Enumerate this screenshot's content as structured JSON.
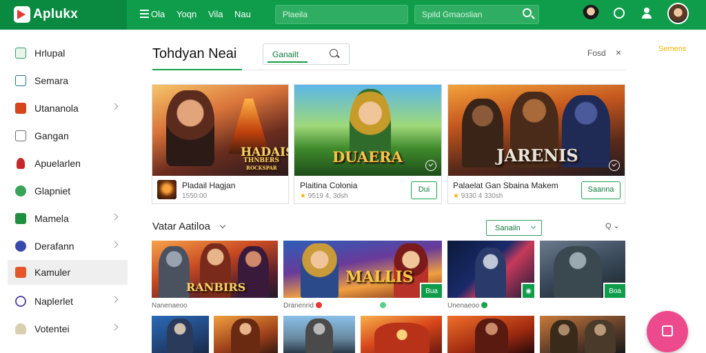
{
  "topbar": {
    "brand": "Aplukx",
    "nav": [
      "Yoqn",
      "Vila",
      "Nau"
    ],
    "menu_label": "Ola",
    "search_placeholder": "Plaeila",
    "search2_placeholder": "Spild Gmaoslian"
  },
  "sidebar": {
    "items": [
      {
        "label": "Hrlupal",
        "icon": "app-icon",
        "color": "#2e9e5d",
        "chev": false
      },
      {
        "label": "Semara",
        "icon": "monitor-icon",
        "color": "#1f6f9f",
        "chev": false
      },
      {
        "label": "Utananola",
        "icon": "grid-icon",
        "color": "#d6451b",
        "chev": true
      },
      {
        "label": "Gangan",
        "icon": "window-icon",
        "color": "#6b6b6b",
        "chev": false
      },
      {
        "label": "Apuelarlen",
        "icon": "person-icon",
        "color": "#c62828",
        "chev": false
      },
      {
        "label": "Glapniet",
        "icon": "leaf-icon",
        "color": "#3aa35a",
        "chev": false
      },
      {
        "label": "Mamela",
        "icon": "play-icon",
        "color": "#1f8f3f",
        "chev": true
      },
      {
        "label": "Derafann",
        "icon": "circle-icon",
        "color": "#3949ab",
        "chev": true
      },
      {
        "label": "Kamuler",
        "icon": "flag-icon",
        "color": "#e5572a",
        "chev": false
      },
      {
        "label": "Naplerlet",
        "icon": "ring-icon",
        "color": "#5b4aa8",
        "chev": true
      },
      {
        "label": "Votentei",
        "icon": "user-icon",
        "color": "#8a7a4f",
        "chev": true
      }
    ]
  },
  "main": {
    "title": "Tohdyan Neai",
    "filter_label": "Ganailt",
    "head_link": "Fosd",
    "close_glyph": "×",
    "promo": "Semens",
    "featured": [
      {
        "art_text": "HADAIS",
        "art_sub": "THNBERS",
        "art_line": "ROCKSPAR",
        "name": "Pladail Hagjan",
        "meta": "1550:00",
        "button": ""
      },
      {
        "art_text": "DUAERA",
        "name": "Plaitina Colonia",
        "meta": "9519 4, 3dsh",
        "button": "Dui"
      },
      {
        "art_text": "JARENIS",
        "name": "Palaelat Gan Sbaina Makem",
        "meta": "9330 4 330sh",
        "button": "Saanna"
      }
    ],
    "section_title": "Vatar Aatiloa",
    "sort_label": "Sanaiin",
    "tools": "Q",
    "tiles": [
      {
        "art_text": "RANBIRS",
        "caption": "Nanenaeoo"
      },
      {
        "art_text": "MALLIS",
        "caption": "Dranenrid",
        "badge": "Bua"
      },
      {
        "art_text": "",
        "caption": "Unenaeoo",
        "badge": ""
      },
      {
        "art_text": "",
        "caption": "",
        "badge": "Boa"
      }
    ]
  },
  "colors": {
    "accent": "#0f9d4b",
    "fab": "#ec4a8c",
    "star": "#f2b400"
  }
}
